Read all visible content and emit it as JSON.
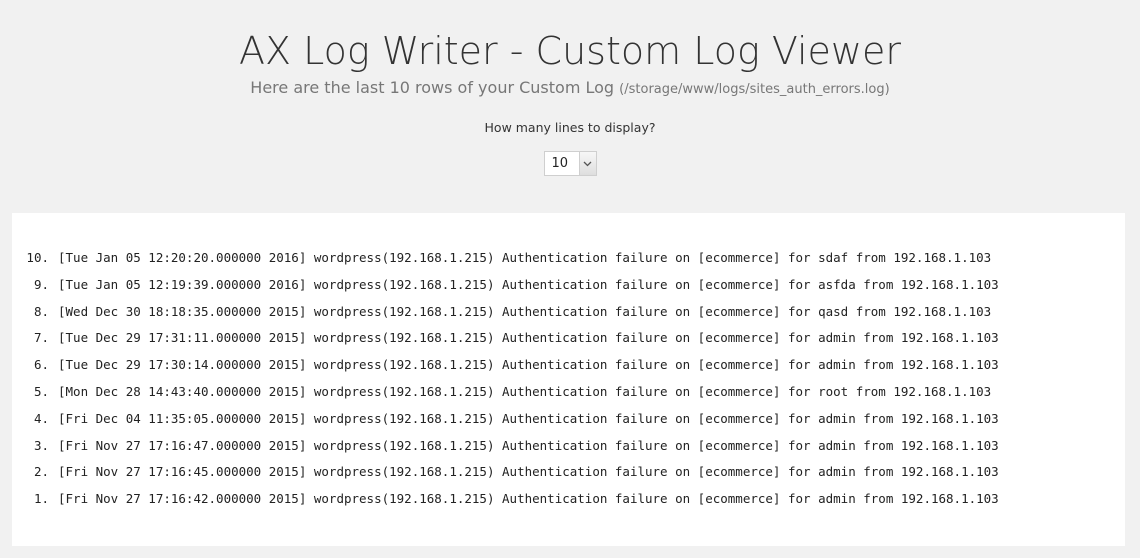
{
  "header": {
    "title": "AX Log Writer - Custom Log Viewer",
    "subtitle": "Here are the last 10 rows of your Custom Log",
    "log_path": "(/storage/www/logs/sites_auth_errors.log)"
  },
  "controls": {
    "lines_label": "How many lines to display?",
    "lines_selected": "10",
    "arrow_icon": "chevron-down-icon"
  },
  "log": {
    "entries": [
      {
        "num": "10.",
        "text": "[Tue Jan 05 12:20:20.000000 2016] wordpress(192.168.1.215) Authentication failure on [ecommerce] for sdaf from 192.168.1.103"
      },
      {
        "num": "9.",
        "text": "[Tue Jan 05 12:19:39.000000 2016] wordpress(192.168.1.215) Authentication failure on [ecommerce] for asfda from 192.168.1.103"
      },
      {
        "num": "8.",
        "text": "[Wed Dec 30 18:18:35.000000 2015] wordpress(192.168.1.215) Authentication failure on [ecommerce] for qasd from 192.168.1.103"
      },
      {
        "num": "7.",
        "text": "[Tue Dec 29 17:31:11.000000 2015] wordpress(192.168.1.215) Authentication failure on [ecommerce] for admin from 192.168.1.103"
      },
      {
        "num": "6.",
        "text": "[Tue Dec 29 17:30:14.000000 2015] wordpress(192.168.1.215) Authentication failure on [ecommerce] for admin from 192.168.1.103"
      },
      {
        "num": "5.",
        "text": "[Mon Dec 28 14:43:40.000000 2015] wordpress(192.168.1.215) Authentication failure on [ecommerce] for root from 192.168.1.103"
      },
      {
        "num": "4.",
        "text": "[Fri Dec 04 11:35:05.000000 2015] wordpress(192.168.1.215) Authentication failure on [ecommerce] for admin from 192.168.1.103"
      },
      {
        "num": "3.",
        "text": "[Fri Nov 27 17:16:47.000000 2015] wordpress(192.168.1.215) Authentication failure on [ecommerce] for admin from 192.168.1.103"
      },
      {
        "num": "2.",
        "text": "[Fri Nov 27 17:16:45.000000 2015] wordpress(192.168.1.215) Authentication failure on [ecommerce] for admin from 192.168.1.103"
      },
      {
        "num": "1.",
        "text": "[Fri Nov 27 17:16:42.000000 2015] wordpress(192.168.1.215) Authentication failure on [ecommerce] for admin from 192.168.1.103"
      }
    ]
  }
}
